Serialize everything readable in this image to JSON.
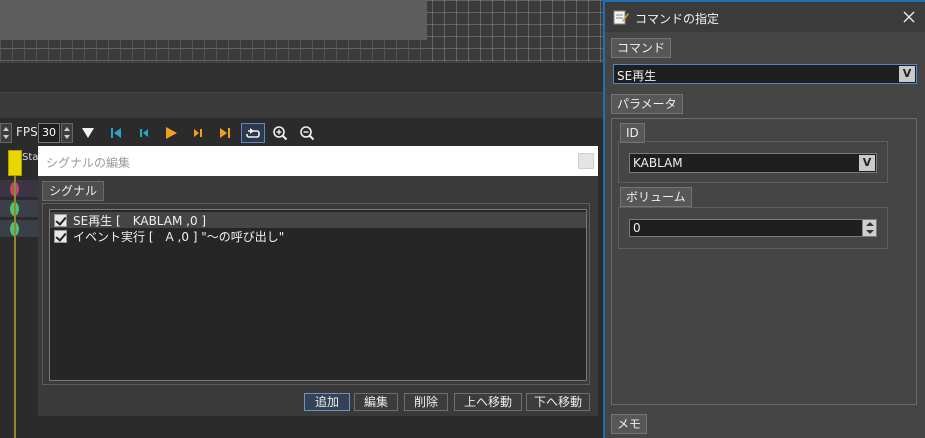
{
  "toolbar": {
    "fps_label": "FPS",
    "fps_value": "30"
  },
  "track": {
    "start_label": "Star"
  },
  "signal_dialog": {
    "title": "シグナルの編集",
    "group_label": "シグナル",
    "signals": [
      {
        "checked": true,
        "text": "SE再生 [　KABLAM ,0 ]",
        "selected": true
      },
      {
        "checked": true,
        "text": "イベント実行 [　A ,0 ] \"〜の呼び出し\"",
        "selected": false
      }
    ],
    "buttons": {
      "add": "追加",
      "edit": "編集",
      "delete": "削除",
      "move_up": "上へ移動",
      "move_down": "下へ移動"
    }
  },
  "command_panel": {
    "title": "コマンドの指定",
    "command_label": "コマンド",
    "command_value": "SE再生",
    "parameter_label": "パラメータ",
    "id_label": "ID",
    "id_value": "KABLAM",
    "volume_label": "ボリューム",
    "volume_value": "0",
    "memo_label": "メモ",
    "dropdown_glyph": "V"
  },
  "colors": {
    "accent": "#1e6fb3",
    "play": "#f0a020",
    "nav": "#2aa6c8",
    "start_marker": "#e8d800"
  }
}
